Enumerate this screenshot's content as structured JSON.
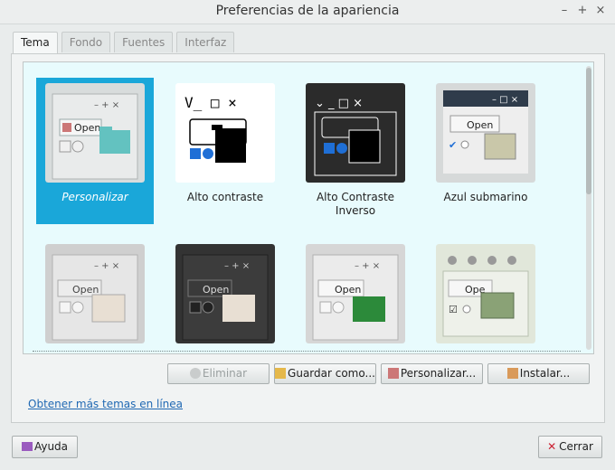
{
  "window": {
    "title": "Preferencias de la apariencia",
    "controls": [
      "–",
      "+",
      "×"
    ]
  },
  "tabs": [
    {
      "label": "Tema",
      "active": true
    },
    {
      "label": "Fondo",
      "active": false
    },
    {
      "label": "Fuentes",
      "active": false
    },
    {
      "label": "Interfaz",
      "active": false
    }
  ],
  "themes": [
    {
      "name": "Personalizar",
      "selected": true,
      "preview_open": "Open"
    },
    {
      "name": "Alto contraste",
      "selected": false
    },
    {
      "name": "Alto Contraste Inverso",
      "selected": false
    },
    {
      "name": "Azul submarino",
      "selected": false,
      "preview_open": "Open"
    },
    {
      "name": "",
      "selected": false,
      "preview_open": "Open"
    },
    {
      "name": "",
      "selected": false,
      "preview_open": "Open"
    },
    {
      "name": "",
      "selected": false,
      "preview_open": "Open"
    },
    {
      "name": "",
      "selected": false,
      "preview_open": "Ope"
    }
  ],
  "actions": {
    "eliminar": "Eliminar",
    "guardar": "Guardar como...",
    "personalizar": "Personalizar...",
    "instalar": "Instalar..."
  },
  "link": "Obtener más temas en línea",
  "footer": {
    "help": "Ayuda",
    "close": "Cerrar"
  },
  "colors": {
    "selection": "#1aa7d9",
    "link": "#1f68b3",
    "content_bg": "#e8fbfd"
  }
}
